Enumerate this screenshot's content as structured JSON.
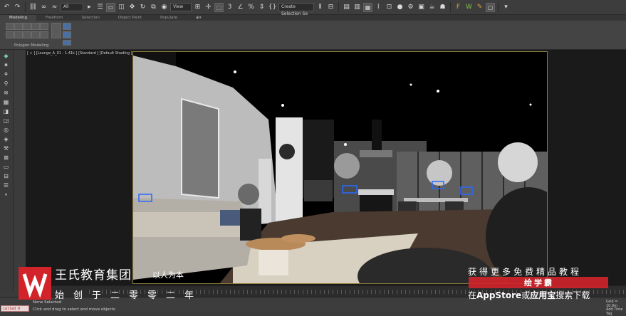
{
  "toolbar": {
    "filter_dropdown": "All",
    "view_dropdown": "View",
    "selection_set": "Create Selection Se"
  },
  "ribbon": {
    "tabs": [
      "Modeling",
      "Freeform",
      "Selection",
      "Object Paint",
      "Populate"
    ],
    "panel_label": "Polygon Modeling"
  },
  "viewport": {
    "label": "[ + ] [Lounge_A_01 - 1.41k ] [Standard ] [Default Shading ]"
  },
  "status": {
    "selection": "None Selected",
    "hint": "Click and drag to select and move objects",
    "maxscript": "called 0",
    "grid": "Grid = 10.0m",
    "time_tag": "Add Time Tag"
  },
  "watermark": {
    "company": "王氏教育集团",
    "slogan": "以人为本",
    "founded": "始创于二零零二年",
    "promo": "获得更多免费精品教程",
    "app_name": "绘学霸",
    "appstore_prefix": "在",
    "appstore_a": "AppStore",
    "appstore_or": "或",
    "appstore_b": "应用宝",
    "appstore_suffix": "搜索下载"
  },
  "colors": {
    "brand_red": "#d2232a",
    "viewport_border": "#8a7a3a",
    "selection_blue": "#2a6aff"
  }
}
